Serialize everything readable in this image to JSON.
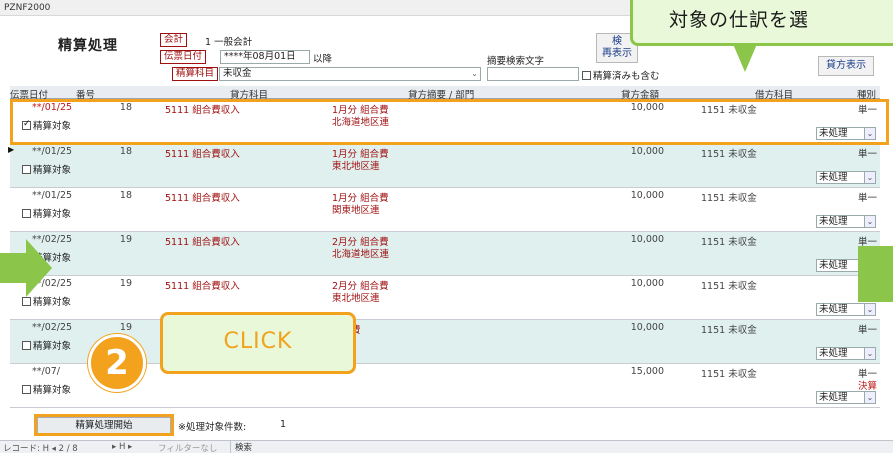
{
  "window": {
    "title": "PZNF2000"
  },
  "header": {
    "form_title": "精算処理",
    "kaikei_label": "会計",
    "kaikei_value": "1 一般会計",
    "date_label": "伝票日付",
    "date_value": "****年08月01日",
    "date_suffix": "以降",
    "account_label": "精算科目",
    "account_value": "未収金",
    "summary_search_label": "摘要検索文字",
    "include_settled_label": "精算済みも含む",
    "search_button": "検",
    "redisplay_button": "再表示",
    "credit_display_button": "貸方表示"
  },
  "columns": [
    "伝票日付",
    "番号",
    "貸方科目",
    "貸方摘要 / 部門",
    "貸方金額",
    "借方科目",
    "種別"
  ],
  "records": [
    {
      "date": "**/01/25",
      "no": "18",
      "credit_account": "5111 組合費収入",
      "desc": "1月分 組合費",
      "dept": "北海道地区連",
      "amount": "10,000",
      "debit_account": "1151 未収金",
      "kind": "単一",
      "kind2": "",
      "checked": true,
      "check_label": "精算対象",
      "status": "未処理",
      "date_red": true
    },
    {
      "date": "**/01/25",
      "no": "18",
      "credit_account": "5111 組合費収入",
      "desc": "1月分 組合費",
      "dept": "東北地区連",
      "amount": "10,000",
      "debit_account": "1151 未収金",
      "kind": "単一",
      "kind2": "",
      "checked": false,
      "check_label": "精算対象",
      "status": "未処理",
      "date_red": false
    },
    {
      "date": "**/01/25",
      "no": "18",
      "credit_account": "5111 組合費収入",
      "desc": "1月分 組合費",
      "dept": "関東地区連",
      "amount": "10,000",
      "debit_account": "1151 未収金",
      "kind": "単一",
      "kind2": "",
      "checked": false,
      "check_label": "精算対象",
      "status": "未処理",
      "date_red": false
    },
    {
      "date": "**/02/25",
      "no": "19",
      "credit_account": "5111 組合費収入",
      "desc": "2月分 組合費",
      "dept": "北海道地区連",
      "amount": "10,000",
      "debit_account": "1151 未収金",
      "kind": "単一",
      "kind2": "",
      "checked": false,
      "check_label": "精算対象",
      "status": "未処理",
      "date_red": false
    },
    {
      "date": "**/02/25",
      "no": "19",
      "credit_account": "5111 組合費収入",
      "desc": "2月分 組合費",
      "dept": "東北地区連",
      "amount": "10,000",
      "debit_account": "1151 未収金",
      "kind": "単一",
      "kind2": "",
      "checked": false,
      "check_label": "精算対象",
      "status": "未処理",
      "date_red": false
    },
    {
      "date": "**/02/25",
      "no": "19",
      "credit_account": "",
      "desc": "組合費",
      "dept": "地連",
      "amount": "10,000",
      "debit_account": "1151 未収金",
      "kind": "単一",
      "kind2": "",
      "checked": false,
      "check_label": "精算対象",
      "status": "未処理",
      "date_red": false
    },
    {
      "date": "**/07/",
      "no": "",
      "credit_account": "",
      "desc": "",
      "dept": "",
      "amount": "15,000",
      "debit_account": "1151 未収金",
      "kind": "単一",
      "kind2": "決算",
      "checked": false,
      "check_label": "精算対象",
      "status": "未処理",
      "date_red": false
    }
  ],
  "footer": {
    "start_button": "精算処理開始",
    "note": "※処理対象件数:",
    "count": "1"
  },
  "navbar": {
    "record_label": "レコード: H ◂ 2 / 8",
    "nav_buttons": "▸ H ▸",
    "filter": "フィルターなし",
    "search": "検索"
  },
  "overlay": {
    "top_callout": "対象の仕訳を選",
    "click_label": "CLICK",
    "step_number": "2"
  },
  "colors": {
    "accent": "#f2a21d",
    "green": "#8bc54a",
    "label_red": "#a01010",
    "alt_row": "#dff0ef"
  }
}
